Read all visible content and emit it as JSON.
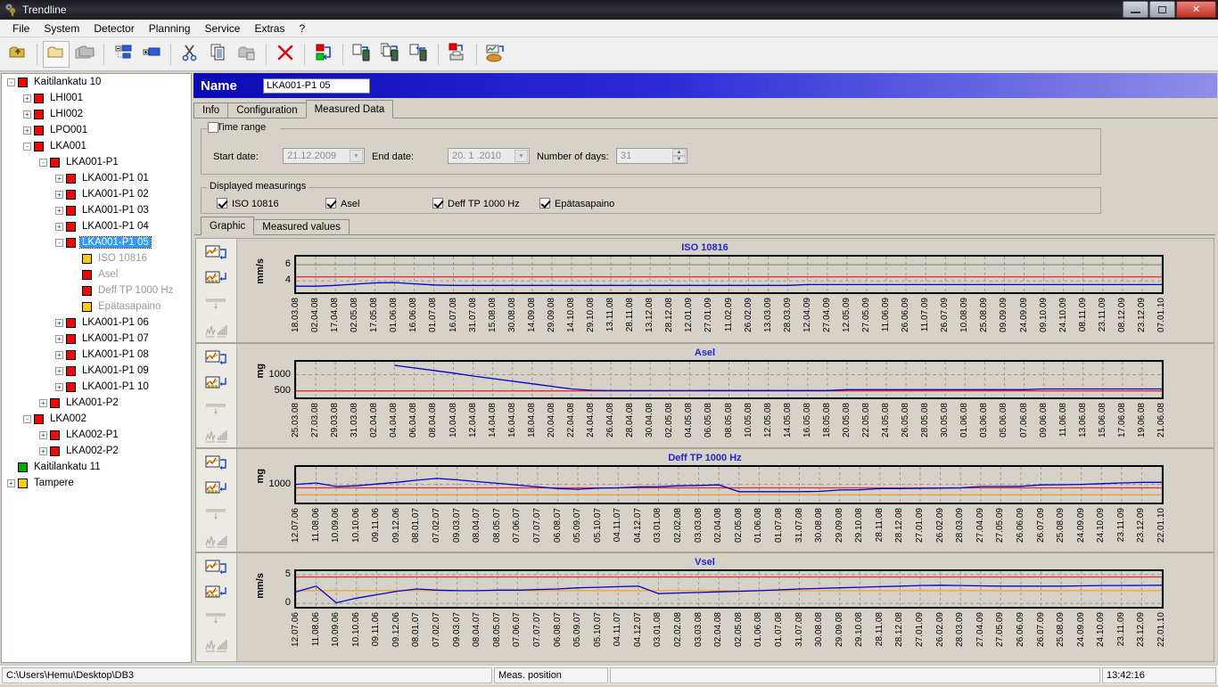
{
  "window": {
    "title": "Trendline",
    "icon": "app-icon",
    "minimize": "–",
    "maximize": "❐",
    "close": "✕"
  },
  "menu": [
    "File",
    "System",
    "Detector",
    "Planning",
    "Service",
    "Extras",
    "?"
  ],
  "toolbar": [
    {
      "name": "open-folder-up-icon"
    },
    {
      "sep": true
    },
    {
      "name": "folder-icon",
      "framed": true
    },
    {
      "name": "copy-folder-icon"
    },
    {
      "sep": true
    },
    {
      "name": "collapse-tree-icon"
    },
    {
      "name": "expand-tree-icon"
    },
    {
      "sep": true
    },
    {
      "name": "cut-icon"
    },
    {
      "name": "copy-icon"
    },
    {
      "name": "paste-icon"
    },
    {
      "sep": true
    },
    {
      "name": "delete-icon"
    },
    {
      "sep": true
    },
    {
      "name": "status-transfer-icon"
    },
    {
      "sep": true
    },
    {
      "name": "send-device-icon"
    },
    {
      "name": "send-multi-device-icon"
    },
    {
      "name": "receive-device-icon"
    },
    {
      "sep": true
    },
    {
      "name": "print-status-icon"
    },
    {
      "sep": true
    },
    {
      "name": "export-chart-icon"
    }
  ],
  "tree": [
    {
      "depth": 0,
      "exp": "-",
      "color": "red",
      "label": "Kaitilankatu 10"
    },
    {
      "depth": 1,
      "exp": "+",
      "color": "red",
      "label": "LHI001"
    },
    {
      "depth": 1,
      "exp": "+",
      "color": "red",
      "label": "LHI002"
    },
    {
      "depth": 1,
      "exp": "+",
      "color": "red",
      "label": "LPO001"
    },
    {
      "depth": 1,
      "exp": "-",
      "color": "red",
      "label": "LKA001"
    },
    {
      "depth": 2,
      "exp": "-",
      "color": "red",
      "label": "LKA001-P1"
    },
    {
      "depth": 3,
      "exp": "+",
      "color": "red",
      "label": "LKA001-P1 01"
    },
    {
      "depth": 3,
      "exp": "+",
      "color": "red",
      "label": "LKA001-P1 02"
    },
    {
      "depth": 3,
      "exp": "+",
      "color": "red",
      "label": "LKA001-P1 03"
    },
    {
      "depth": 3,
      "exp": "+",
      "color": "red",
      "label": "LKA001-P1 04"
    },
    {
      "depth": 3,
      "exp": "-",
      "color": "red",
      "label": "LKA001-P1 05",
      "selected": true
    },
    {
      "depth": 4,
      "exp": "",
      "color": "yellow",
      "label": "ISO 10816",
      "dim": true
    },
    {
      "depth": 4,
      "exp": "",
      "color": "red",
      "label": "Asel",
      "dim": true
    },
    {
      "depth": 4,
      "exp": "",
      "color": "red",
      "label": "Deff TP 1000 Hz",
      "dim": true
    },
    {
      "depth": 4,
      "exp": "",
      "color": "yellow",
      "label": "Epätasapaino",
      "dim": true
    },
    {
      "depth": 3,
      "exp": "+",
      "color": "red",
      "label": "LKA001-P1 06"
    },
    {
      "depth": 3,
      "exp": "+",
      "color": "red",
      "label": "LKA001-P1 07"
    },
    {
      "depth": 3,
      "exp": "+",
      "color": "red",
      "label": "LKA001-P1 08"
    },
    {
      "depth": 3,
      "exp": "+",
      "color": "red",
      "label": "LKA001-P1 09"
    },
    {
      "depth": 3,
      "exp": "+",
      "color": "red",
      "label": "LKA001-P1 10"
    },
    {
      "depth": 2,
      "exp": "+",
      "color": "red",
      "label": "LKA001-P2"
    },
    {
      "depth": 1,
      "exp": "-",
      "color": "red",
      "label": "LKA002"
    },
    {
      "depth": 2,
      "exp": "+",
      "color": "red",
      "label": "LKA002-P1"
    },
    {
      "depth": 2,
      "exp": "+",
      "color": "red",
      "label": "LKA002-P2"
    },
    {
      "depth": 0,
      "exp": "",
      "color": "green",
      "label": "Kaitilankatu 11"
    },
    {
      "depth": 0,
      "exp": "+",
      "color": "yellow",
      "label": "Tampere"
    }
  ],
  "name_bar": {
    "label": "Name",
    "value": "LKA001-P1 05"
  },
  "tabs_main": [
    {
      "label": "Info",
      "active": false
    },
    {
      "label": "Configuration",
      "active": false
    },
    {
      "label": "Measured Data",
      "active": true
    }
  ],
  "time_range": {
    "group_label": "Time range",
    "checked": false,
    "start_label": "Start date:",
    "start_value": "21.12.2009",
    "end_label": "End date:",
    "end_value": "20. 1 .2010",
    "days_label": "Number of days:",
    "days_value": "31"
  },
  "displayed_measurings": {
    "group_label": "Displayed measurings",
    "items": [
      {
        "label": "ISO 10816",
        "checked": true
      },
      {
        "label": "Asel",
        "checked": true
      },
      {
        "label": "Deff TP 1000 Hz",
        "checked": true
      },
      {
        "label": "Epätasapaino",
        "checked": true
      }
    ]
  },
  "tabs_view": [
    {
      "label": "Graphic",
      "active": true
    },
    {
      "label": "Measured values",
      "active": false
    }
  ],
  "chart_side_buttons": [
    {
      "name": "chart-zoom-in-icon"
    },
    {
      "name": "chart-zoom-out-icon"
    },
    {
      "name": "chart-scale-icon"
    },
    {
      "name": "chart-type-icon"
    },
    {
      "name": "chart-print-icon"
    }
  ],
  "statusbar": {
    "path": "C:\\Users\\Hemu\\Desktop\\DB3",
    "meas_position": "Meas. position",
    "time": "13:42:16"
  },
  "chart_data": [
    {
      "type": "line",
      "title": "ISO 10816",
      "ylabel": "mm/s",
      "xlabel": "",
      "ylim": [
        2.6,
        7.0
      ],
      "yticks": [
        4,
        6
      ],
      "grid": true,
      "legend": "none",
      "categories": [
        "18.03.08",
        "02.04.08",
        "17.04.08",
        "02.05.08",
        "17.05.08",
        "01.06.08",
        "16.06.08",
        "01.07.08",
        "16.07.08",
        "31.07.08",
        "15.08.08",
        "30.08.08",
        "14.09.08",
        "29.09.08",
        "14.10.08",
        "29.10.08",
        "13.11.08",
        "28.11.08",
        "13.12.08",
        "28.12.08",
        "12.01.09",
        "27.01.09",
        "11.02.09",
        "26.02.09",
        "13.03.09",
        "28.03.09",
        "12.04.09",
        "27.04.09",
        "12.05.09",
        "27.05.09",
        "11.06.09",
        "26.06.09",
        "11.07.09",
        "26.07.09",
        "10.08.09",
        "25.08.09",
        "09.09.09",
        "24.09.09",
        "09.10.09",
        "24.10.09",
        "08.11.09",
        "23.11.09",
        "08.12.09",
        "23.12.09",
        "07.01.10"
      ],
      "series": [
        {
          "name": "measurement",
          "color": "#0000cc",
          "values": [
            3.35,
            3.35,
            3.45,
            3.6,
            3.75,
            3.8,
            3.65,
            3.5,
            3.45,
            3.45,
            3.45,
            3.45,
            3.45,
            3.45,
            3.45,
            3.45,
            3.45,
            3.45,
            3.45,
            3.45,
            3.45,
            3.45,
            3.45,
            3.45,
            3.45,
            3.45,
            3.55,
            3.55,
            3.55,
            3.55,
            3.55,
            3.55,
            3.55,
            3.55,
            3.55,
            3.55,
            3.55,
            3.55,
            3.55,
            3.55,
            3.55,
            3.55,
            3.55,
            3.55,
            3.55
          ]
        },
        {
          "name": "alarm-limit",
          "color": "#e03030",
          "constant": 4.5
        },
        {
          "name": "warn-limit",
          "color": "#909090",
          "constant": 6.0
        }
      ]
    },
    {
      "type": "line",
      "title": "Asel",
      "ylabel": "mg",
      "xlabel": "",
      "ylim": [
        300,
        1400
      ],
      "yticks": [
        500,
        1000
      ],
      "grid": true,
      "legend": "none",
      "categories": [
        "25.03.08",
        "27.03.08",
        "29.03.08",
        "31.03.08",
        "02.04.08",
        "04.04.08",
        "06.04.08",
        "08.04.08",
        "10.04.08",
        "12.04.08",
        "14.04.08",
        "16.04.08",
        "18.04.08",
        "20.04.08",
        "22.04.08",
        "24.04.08",
        "26.04.08",
        "28.04.08",
        "30.04.08",
        "02.05.08",
        "04.05.08",
        "06.05.08",
        "08.05.08",
        "10.05.08",
        "12.05.08",
        "14.05.08",
        "16.05.08",
        "18.05.08",
        "20.05.08",
        "22.05.08",
        "24.05.08",
        "26.05.08",
        "28.05.08",
        "30.05.08",
        "01.06.08",
        "03.06.08",
        "05.06.08",
        "07.06.08",
        "09.06.08",
        "11.06.08",
        "13.06.08",
        "15.06.08",
        "17.06.08",
        "19.06.08",
        "21.06.08"
      ],
      "series": [
        {
          "name": "measurement",
          "color": "#0000cc",
          "values": [
            null,
            null,
            null,
            null,
            null,
            1290,
            1210,
            1130,
            1050,
            960,
            880,
            800,
            720,
            640,
            560,
            520,
            510,
            510,
            510,
            510,
            510,
            512,
            512,
            512,
            512,
            512,
            512,
            512,
            540,
            540,
            540,
            540,
            540,
            540,
            540,
            540,
            540,
            540,
            560,
            560,
            560,
            560,
            560,
            560,
            560
          ]
        },
        {
          "name": "alarm-limit",
          "color": "#e03030",
          "constant": 500
        }
      ]
    },
    {
      "type": "line",
      "title": "Deff TP 1000 Hz",
      "ylabel": "mg",
      "xlabel": "",
      "ylim": [
        480,
        1500
      ],
      "yticks": [
        1000
      ],
      "grid": true,
      "legend": "none",
      "categories": [
        "12.07.06",
        "11.08.06",
        "10.09.06",
        "10.10.06",
        "09.11.06",
        "09.12.06",
        "08.01.07",
        "07.02.07",
        "09.03.07",
        "08.04.07",
        "08.05.07",
        "07.06.07",
        "07.07.07",
        "06.08.07",
        "05.09.07",
        "05.10.07",
        "04.11.07",
        "04.12.07",
        "03.01.08",
        "02.02.08",
        "03.03.08",
        "02.04.08",
        "02.05.08",
        "01.06.08",
        "01.07.08",
        "31.07.08",
        "30.08.08",
        "29.09.08",
        "29.10.08",
        "28.11.08",
        "28.12.08",
        "27.01.09",
        "26.02.09",
        "28.03.09",
        "27.04.09",
        "27.05.09",
        "26.06.09",
        "26.07.09",
        "25.08.09",
        "24.09.09",
        "24.10.09",
        "23.11.09",
        "23.12.09",
        "22.01.10"
      ],
      "series": [
        {
          "name": "measurement",
          "color": "#0000cc",
          "values": [
            1000,
            1040,
            940,
            960,
            1010,
            1060,
            1120,
            1170,
            1130,
            1080,
            1030,
            980,
            930,
            880,
            860,
            890,
            900,
            930,
            935,
            960,
            970,
            985,
            790,
            790,
            790,
            790,
            800,
            840,
            845,
            880,
            880,
            885,
            890,
            900,
            940,
            940,
            945,
            985,
            990,
            1000,
            1020,
            1040,
            1060,
            1060
          ]
        },
        {
          "name": "alarm-limit",
          "color": "#e03030",
          "constant": 900
        },
        {
          "name": "warn-limit",
          "color": "#f0a030",
          "constant": 700
        }
      ]
    },
    {
      "type": "line",
      "title": "Vsel",
      "ylabel": "mm/s",
      "xlabel": "",
      "ylim": [
        -0.6,
        5.6
      ],
      "yticks": [
        0,
        5
      ],
      "grid": true,
      "legend": "none",
      "categories": [
        "12.07.06",
        "11.08.06",
        "10.09.06",
        "10.10.06",
        "09.11.06",
        "09.12.06",
        "08.01.07",
        "07.02.07",
        "09.03.07",
        "08.04.07",
        "08.05.07",
        "07.06.07",
        "07.07.07",
        "06.08.07",
        "05.09.07",
        "05.10.07",
        "04.11.07",
        "04.12.07",
        "03.01.08",
        "02.02.08",
        "03.03.08",
        "02.04.08",
        "02.05.08",
        "01.06.08",
        "01.07.08",
        "31.07.08",
        "30.08.08",
        "29.09.08",
        "29.10.08",
        "28.11.08",
        "28.12.08",
        "27.01.09",
        "26.02.09",
        "28.03.09",
        "27.04.09",
        "27.05.09",
        "26.06.09",
        "26.07.09",
        "25.08.09",
        "24.09.09",
        "24.10.09",
        "23.11.09",
        "23.12.09",
        "22.01.10"
      ],
      "series": [
        {
          "name": "measurement",
          "color": "#0000cc",
          "values": [
            2.0,
            3.0,
            0.1,
            0.9,
            1.5,
            2.1,
            2.5,
            2.3,
            2.2,
            2.2,
            2.3,
            2.3,
            2.4,
            2.5,
            2.7,
            2.8,
            2.9,
            3.0,
            1.7,
            1.8,
            1.9,
            2.0,
            2.1,
            2.2,
            2.35,
            2.5,
            2.6,
            2.7,
            2.8,
            2.9,
            3.0,
            3.1,
            3.15,
            3.1,
            3.05,
            3.0,
            3.0,
            3.0,
            3.0,
            3.05,
            3.1,
            3.1,
            3.12,
            3.15
          ]
        },
        {
          "name": "alarm-limit",
          "color": "#e03030",
          "constant": 4.6
        },
        {
          "name": "warn-limit",
          "color": "#f0a030",
          "constant": 2.2
        }
      ]
    }
  ]
}
